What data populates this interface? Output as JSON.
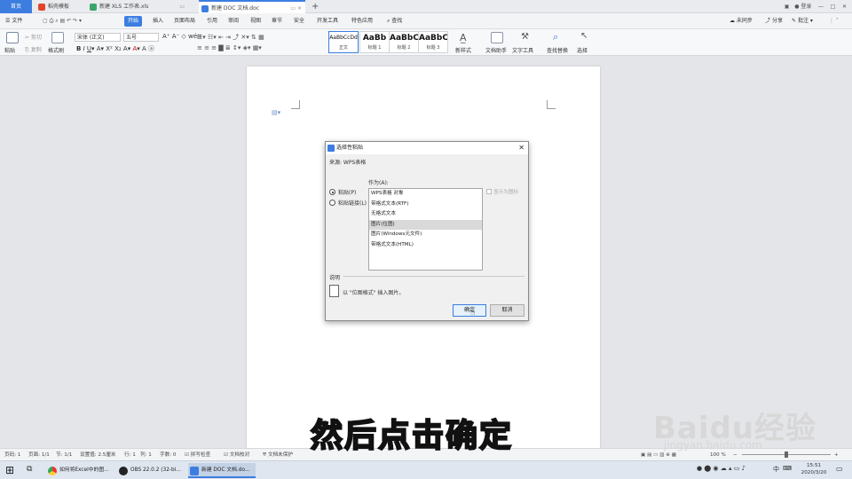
{
  "tabs": {
    "home": "首页",
    "items": [
      {
        "label": "稻壳模板"
      },
      {
        "label": "新建 XLS 工作表.xls"
      },
      {
        "label": "新建 DOC 文档.doc"
      }
    ],
    "right_label": "登录"
  },
  "menu": {
    "file": "文件",
    "items": [
      "开始",
      "插入",
      "页面布局",
      "引用",
      "审阅",
      "视图",
      "章节",
      "安全",
      "开发工具",
      "特色应用"
    ],
    "search": "查找",
    "right": [
      "未同步",
      "分享",
      "批注"
    ]
  },
  "ribbon": {
    "paste": "粘贴",
    "cut": "剪切",
    "copy": "复制",
    "format_painter": "格式刷",
    "font_name": "宋体 (正文)",
    "font_size": "五号",
    "styles": [
      {
        "sample": "AaBbCcDd",
        "name": "正文"
      },
      {
        "sample": "AaBb",
        "name": "标题 1"
      },
      {
        "sample": "AaBbC",
        "name": "标题 2"
      },
      {
        "sample": "AaBbC",
        "name": "标题 3"
      }
    ],
    "new_style": "新样式",
    "doc_assistant": "文档助手",
    "text_tools": "文字工具",
    "find_replace": "查找替换",
    "select": "选择"
  },
  "dialog": {
    "title": "选择性粘贴",
    "source": "来源: WPS表格",
    "as_label": "作为(A):",
    "radio_paste": "粘贴(P)",
    "radio_link": "粘贴链接(L)",
    "options": [
      "WPS表格 对象",
      "带格式文本(RTF)",
      "无格式文本",
      "图片(位图)",
      "图片(Windows元文件)",
      "带格式文本(HTML)"
    ],
    "selected_index": 3,
    "show_icon": "显示为图标",
    "desc_label": "说明",
    "desc_text": "以 \"位图格式\" 插入图片。",
    "ok": "确定",
    "cancel": "取消"
  },
  "status": {
    "page": "页码: 1",
    "pages": "页面: 1/1",
    "section": "节: 1/1",
    "setting": "设置值: 2.5厘米",
    "row": "行: 1",
    "col": "列: 1",
    "words": "字数: 0",
    "spell": "拼写检查",
    "proof": "文档校对",
    "protect": "文档未保护",
    "zoom": "100 %"
  },
  "taskbar": {
    "apps": [
      "如何将Excel中的图...",
      "OBS 22.0.2 (32-bi...",
      "新建 DOC 文档.do..."
    ],
    "time": "15:51",
    "date": "2020/3/20",
    "ime": "中"
  },
  "caption": "然后点击确定",
  "watermark": {
    "brand": "Baidu经验",
    "url": "jingyan.baidu.com"
  },
  "colors": {
    "accent": "#3d7de0"
  }
}
